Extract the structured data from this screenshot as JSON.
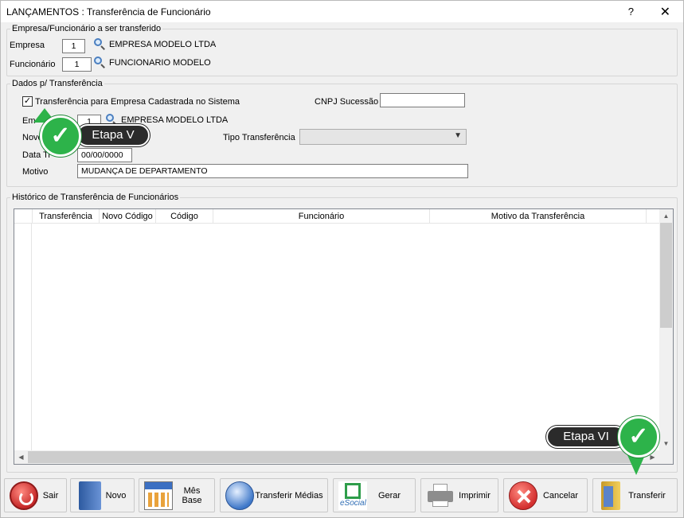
{
  "window": {
    "title": "LANÇAMENTOS : Transferência de Funcionário",
    "help_label": "?",
    "close_label": "✕"
  },
  "source_group": {
    "legend": "Empresa/Funcionário a ser transferido",
    "empresa_label": "Empresa",
    "empresa_code": "1",
    "empresa_name": "EMPRESA MODELO LTDA",
    "funcionario_label": "Funcionário",
    "funcionario_code": "1",
    "funcionario_name": "FUNCIONARIO MODELO"
  },
  "transfer_group": {
    "legend": "Dados p/ Transferência",
    "checkbox_label": "Transferência para Empresa Cadastrada no Sistema",
    "checkbox_checked": true,
    "cnpj_label": "CNPJ Sucessão",
    "cnpj_value": "",
    "empresa_label_partial": "Em",
    "empresa_code": "1",
    "empresa_name": "EMPRESA MODELO LTDA",
    "novo_label_partial": "Novo",
    "tipo_label": "Tipo Transferência",
    "tipo_value": "",
    "data_label_partial": "Data Tr",
    "data_value": "00/00/0000",
    "motivo_label": "Motivo",
    "motivo_value": "MUDANÇA DE DEPARTAMENTO"
  },
  "history_group": {
    "legend": "Histórico de Transferência de Funcionários",
    "columns": [
      "Transferência",
      "Novo Código",
      "Código",
      "Funcionário",
      "Motivo da Transferência"
    ],
    "rows": []
  },
  "toolbar": {
    "sair": "Sair",
    "novo": "Novo",
    "mes_base": "Mês Base",
    "transferir_medias": "Transferir Médias",
    "esocial_logo": "eSocial",
    "gerar": "Gerar",
    "imprimir": "Imprimir",
    "cancelar": "Cancelar",
    "transferir": "Transferir"
  },
  "callouts": {
    "step_v": "Etapa V",
    "step_vi": "Etapa VI",
    "check_glyph": "✓"
  },
  "colors": {
    "callout_green": "#2db34a",
    "callout_dark": "#2b2b2b"
  }
}
